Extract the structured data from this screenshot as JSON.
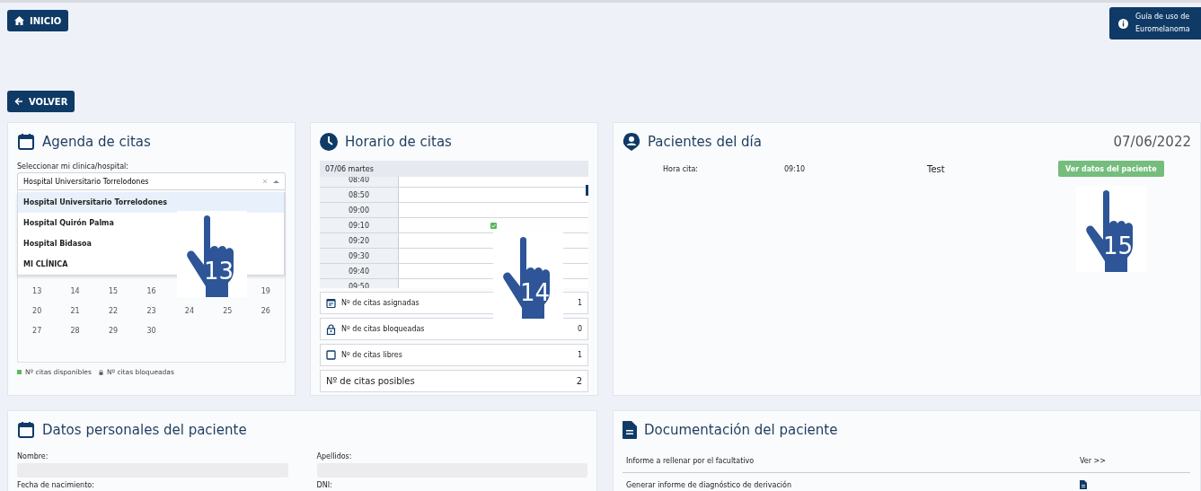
{
  "header": {
    "home_button": "INICIO",
    "guide_button": "Guía de uso de Euromelanoma",
    "back_button": "VOLVER"
  },
  "agenda": {
    "title": "Agenda de citas",
    "select_label": "Seleccionar mi clinica/hospital:",
    "select_value": "Hospital Universitario Torrelodones",
    "dropdown_open": true,
    "options": [
      {
        "label": "Hospital Universitario Torrelodones",
        "selected": true
      },
      {
        "label": "Hospital Quirón Palma",
        "selected": false
      },
      {
        "label": "Hospital Bidasoa",
        "selected": false
      },
      {
        "label": "MI CLÍNICA",
        "selected": false
      }
    ],
    "calendar_rows": [
      [
        "13",
        "14",
        "15",
        "16",
        "",
        "",
        "19"
      ],
      [
        "20",
        "21",
        "22",
        "23",
        "24",
        "25",
        "26"
      ],
      [
        "27",
        "28",
        "29",
        "30",
        "",
        "",
        ""
      ]
    ],
    "legend": [
      {
        "kind": "available",
        "label": "Nº citas disponibles"
      },
      {
        "kind": "blocked",
        "label": "Nº citas bloqueadas"
      }
    ],
    "callout": "13"
  },
  "schedule": {
    "title": "Horario de citas",
    "day": "07/06 martes",
    "slots": [
      {
        "time": "08:40",
        "booked": false
      },
      {
        "time": "08:50",
        "booked": false
      },
      {
        "time": "09:00",
        "booked": false
      },
      {
        "time": "09:10",
        "booked": true
      },
      {
        "time": "09:20",
        "booked": false
      },
      {
        "time": "09:30",
        "booked": false
      },
      {
        "time": "09:40",
        "booked": false
      },
      {
        "time": "09:50",
        "booked": false
      }
    ],
    "stats": [
      {
        "kind": "assigned",
        "label": "Nº de citas asignadas",
        "value": "1"
      },
      {
        "kind": "blocked",
        "label": "Nº de citas bloqueadas",
        "value": "0"
      },
      {
        "kind": "free",
        "label": "Nº de citas libres",
        "value": "1"
      },
      {
        "kind": "total",
        "label": "Nº de citas posibles",
        "value": "2"
      }
    ],
    "callout": "14"
  },
  "patients": {
    "title": "Pacientes del día",
    "date": "07/06/2022",
    "rows": [
      {
        "label": "Hora cita:",
        "time": "09:10",
        "name": "Test",
        "action": "Ver datos del paciente"
      }
    ],
    "callout": "15"
  },
  "personal": {
    "title": "Datos personales del paciente",
    "fields": [
      {
        "label": "Nombre:"
      },
      {
        "label": "Apellidos:"
      },
      {
        "label": "Fecha de nacimiento:"
      },
      {
        "label": "DNI:"
      }
    ]
  },
  "documents": {
    "title": "Documentación del paciente",
    "rows": [
      {
        "kind": "link",
        "label": "Informe a rellenar por el facultativo",
        "action": "Ver >>"
      },
      {
        "kind": "file",
        "label": "Generar informe de diagnóstico de derivación"
      }
    ]
  }
}
